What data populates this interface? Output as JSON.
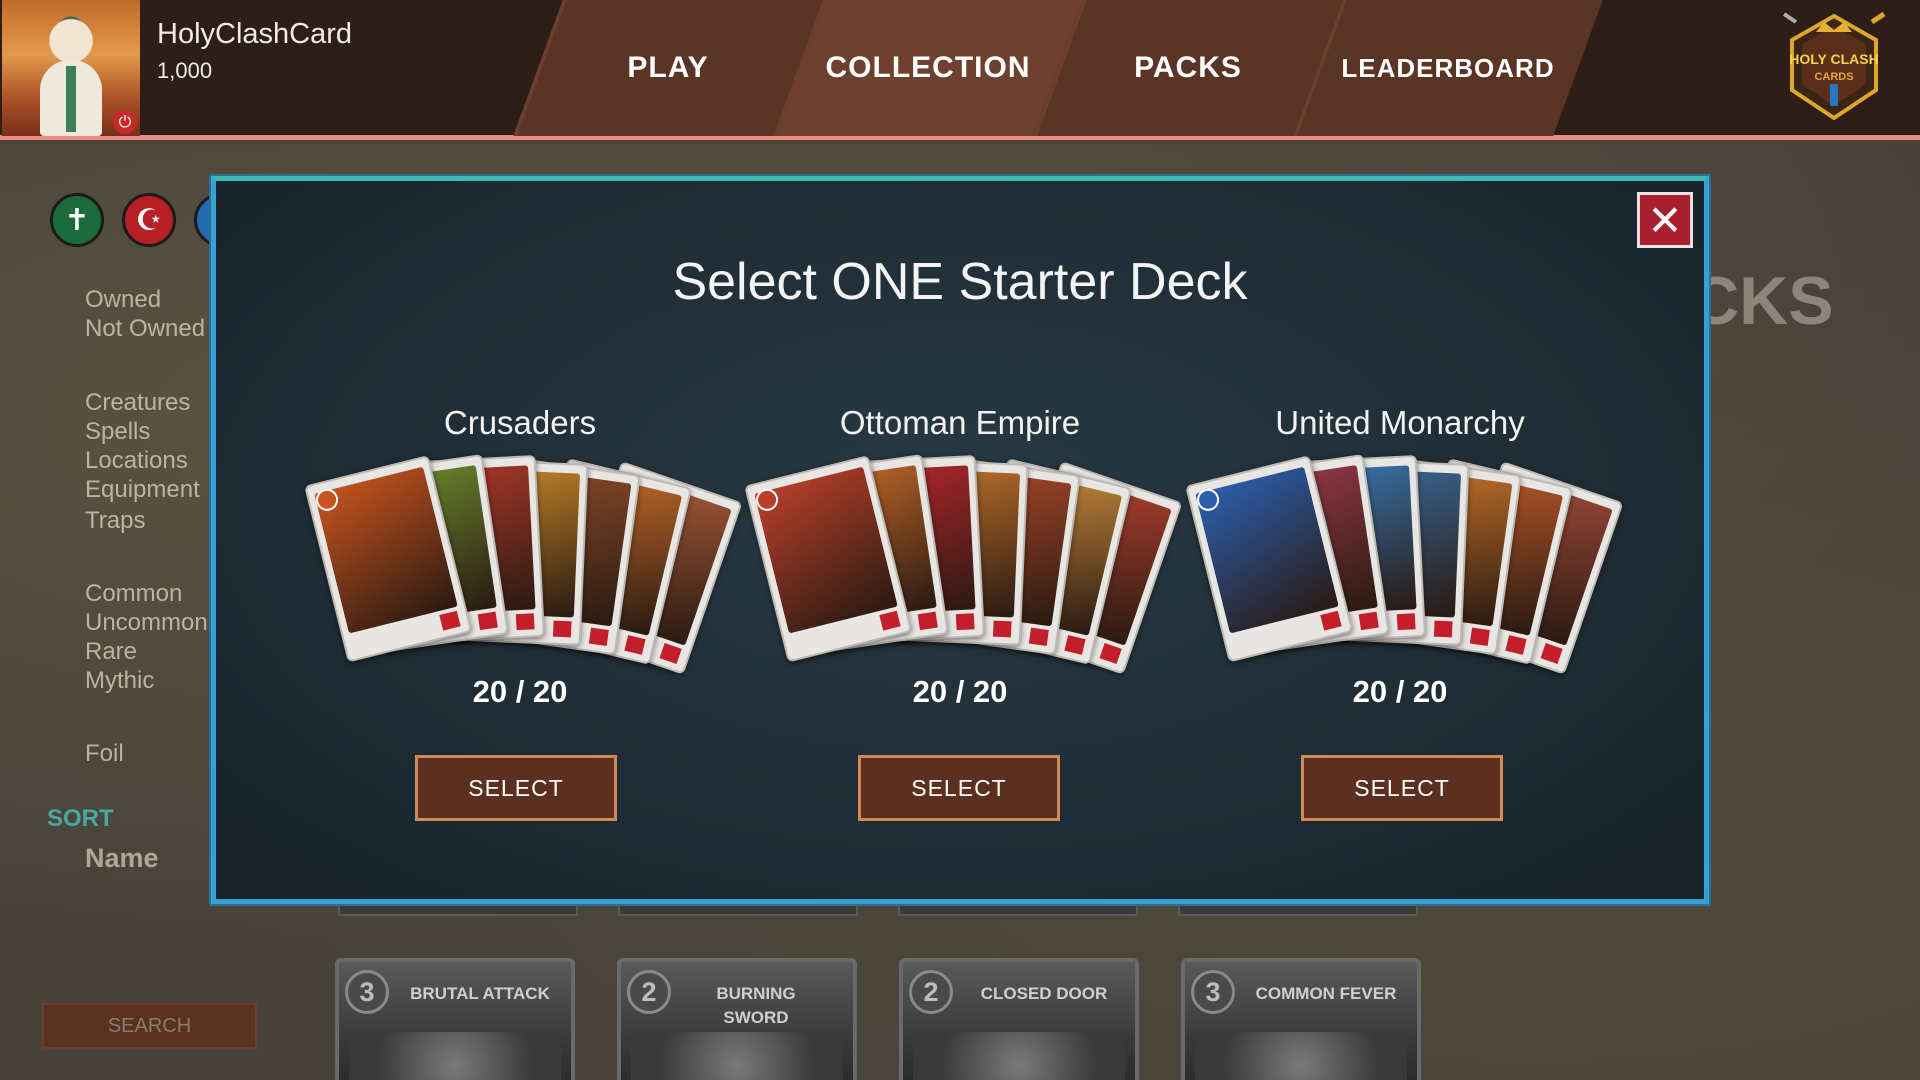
{
  "player": {
    "name": "HolyClashCard",
    "coins": "1,000"
  },
  "nav": {
    "play": "PLAY",
    "collection": "COLLECTION",
    "packs": "PACKS",
    "leaderboard": "LEADERBOARD"
  },
  "logo": {
    "line1": "HOLY CLASH",
    "line2": "CARDS"
  },
  "filters": {
    "ownership": [
      "Owned",
      "Not Owned"
    ],
    "types": [
      "Creatures",
      "Spells",
      "Locations",
      "Equipment",
      "Traps"
    ],
    "rarities": [
      "Common",
      "Uncommon",
      "Rare",
      "Mythic"
    ],
    "foil": "Foil",
    "sort_label": "SORT",
    "sort_value": "Name",
    "search_button": "SEARCH",
    "faction_icons": [
      "cross-icon",
      "crescent-icon",
      "crown-icon"
    ]
  },
  "background": {
    "title_fragment": "CKS",
    "cards": [
      {
        "cost": "3",
        "name": "BRUTAL ATTACK"
      },
      {
        "cost": "2",
        "name": "BURNING SWORD"
      },
      {
        "cost": "2",
        "name": "CLOSED DOOR"
      },
      {
        "cost": "3",
        "name": "COMMON FEVER"
      }
    ]
  },
  "modal": {
    "title": "Select ONE Starter Deck",
    "close_icon": "close-icon",
    "decks": [
      {
        "name": "Crusaders",
        "count": "20 / 20",
        "button": "SELECT",
        "accent": "#c8541f"
      },
      {
        "name": "Ottoman Empire",
        "count": "20 / 20",
        "button": "SELECT",
        "accent": "#b8402a"
      },
      {
        "name": "United Monarchy",
        "count": "20 / 20",
        "button": "SELECT",
        "accent": "#2c5fb0"
      }
    ]
  },
  "colors": {
    "topbar_border": "#e98b86",
    "modal_border": "#38a0d6",
    "select_border": "#d08a55",
    "close_bg": "#aa1f2e"
  }
}
